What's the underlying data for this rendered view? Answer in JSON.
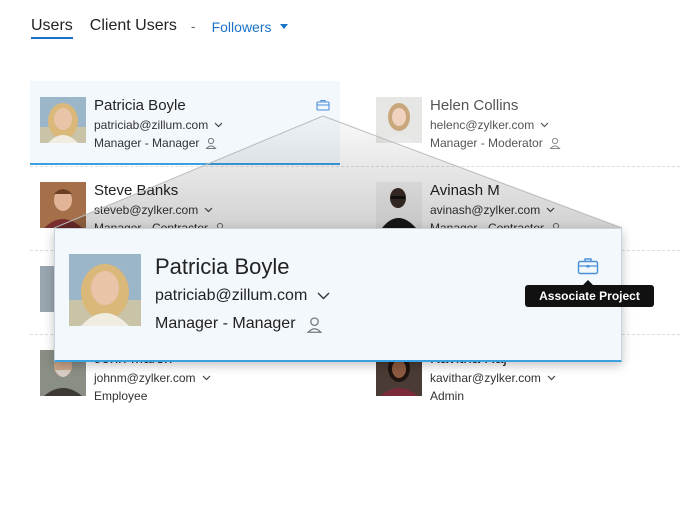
{
  "tabs": {
    "users": "Users",
    "client_users": "Client Users",
    "separator": "-",
    "followers": "Followers"
  },
  "users": [
    {
      "name": "Patricia Boyle",
      "email": "patriciab@zillum.com",
      "role": "Manager - Manager",
      "avatar": "avatar-patricia"
    },
    {
      "name": "Helen Collins",
      "email": "helenc@zylker.com",
      "role": "Manager - Moderator",
      "avatar": "avatar-helen"
    },
    {
      "name": "Steve Banks",
      "email": "steveb@zylker.com",
      "role": "Manager - Contractor",
      "avatar": "avatar-steve"
    },
    {
      "name": "Avinash M",
      "email": "avinash@zylker.com",
      "role": "Manager - Contractor",
      "avatar": "avatar-avinash"
    },
    {
      "name": "John Marsh",
      "email": "johnm@zylker.com",
      "role": "Employee",
      "avatar": "avatar-john"
    },
    {
      "name": "Kavitha Raj",
      "email": "kavithar@zylker.com",
      "role": "Admin",
      "avatar": "avatar-kavitha"
    }
  ],
  "zoom": {
    "name": "Patricia Boyle",
    "email": "patriciab@zillum.com",
    "role": "Manager - Manager",
    "action_icon": "briefcase-icon"
  },
  "tooltip": {
    "label": "Associate Project"
  },
  "colors": {
    "accent": "#1a73c8",
    "selected_bg": "#f3f8fd",
    "selected_border": "#3aa0e0"
  }
}
